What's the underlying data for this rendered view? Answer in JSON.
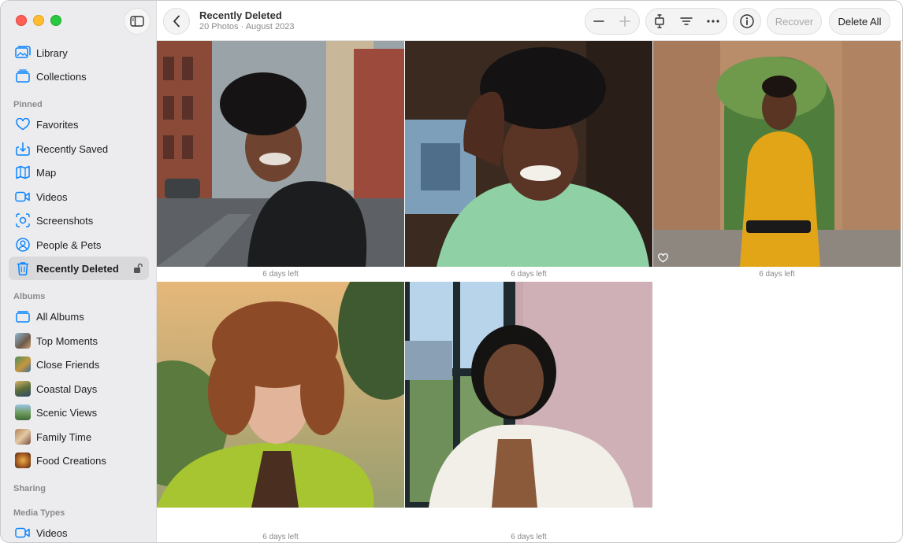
{
  "window": {
    "title": "Recently Deleted",
    "subtitle": "20 Photos · August 2023"
  },
  "sidebar": {
    "top_items": [
      {
        "label": "Library",
        "icon": "photo-library-icon"
      },
      {
        "label": "Collections",
        "icon": "collections-icon"
      }
    ],
    "pinned_header": "Pinned",
    "pinned_items": [
      {
        "label": "Favorites",
        "icon": "heart-icon"
      },
      {
        "label": "Recently Saved",
        "icon": "download-icon"
      },
      {
        "label": "Map",
        "icon": "map-icon"
      },
      {
        "label": "Videos",
        "icon": "video-icon"
      },
      {
        "label": "Screenshots",
        "icon": "screenshot-icon"
      },
      {
        "label": "People & Pets",
        "icon": "person-icon"
      },
      {
        "label": "Recently Deleted",
        "icon": "trash-icon",
        "selected": true
      }
    ],
    "albums_header": "Albums",
    "album_items": [
      {
        "label": "All Albums",
        "icon": "albums-icon"
      },
      {
        "label": "Top Moments",
        "icon": "album-thumbnail"
      },
      {
        "label": "Close Friends",
        "icon": "album-thumbnail"
      },
      {
        "label": "Coastal Days",
        "icon": "album-thumbnail"
      },
      {
        "label": "Scenic Views",
        "icon": "album-thumbnail"
      },
      {
        "label": "Family Time",
        "icon": "album-thumbnail"
      },
      {
        "label": "Food Creations",
        "icon": "album-thumbnail"
      }
    ],
    "sharing_header": "Sharing",
    "media_types_header": "Media Types",
    "media_items": [
      {
        "label": "Videos",
        "icon": "video-icon"
      }
    ]
  },
  "toolbar": {
    "recover_label": "Recover",
    "delete_all_label": "Delete All"
  },
  "photos": [
    {
      "caption": "6 days left"
    },
    {
      "caption": "6 days left"
    },
    {
      "caption": "6 days left",
      "favorite": true
    },
    {
      "caption": "6 days left"
    },
    {
      "caption": "6 days left"
    }
  ],
  "colors": {
    "accent": "#007aff",
    "sidebar_bg": "#ececee",
    "selected_bg": "#d9d9dc"
  }
}
